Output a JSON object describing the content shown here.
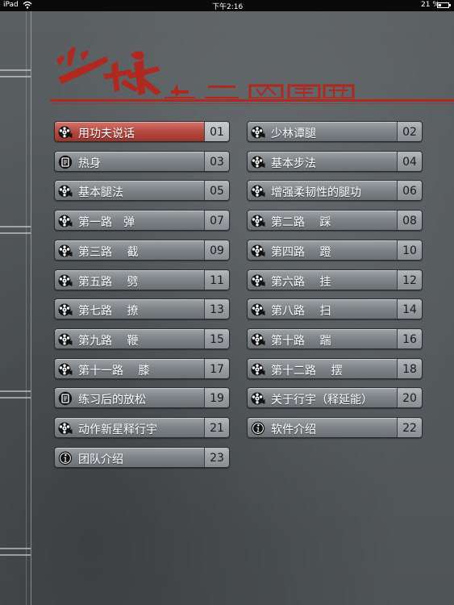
{
  "status_bar": {
    "device": "iPad",
    "time": "下午2:16",
    "battery": "21 %"
  },
  "header": {
    "logo_text": "少林十二路谭腿",
    "accent_color": "#b0281f"
  },
  "menu": [
    {
      "label": "用功夫说话",
      "number": "01",
      "icon": "film-reel-icon",
      "active": true
    },
    {
      "label": "少林谭腿",
      "number": "02",
      "icon": "film-reel-icon"
    },
    {
      "label": "热身",
      "number": "03",
      "icon": "document-icon"
    },
    {
      "label": "基本步法",
      "number": "04",
      "icon": "film-reel-icon"
    },
    {
      "label": "基本腿法",
      "number": "05",
      "icon": "film-reel-icon"
    },
    {
      "label": "增强柔韧性的腿功",
      "number": "06",
      "icon": "film-reel-icon"
    },
    {
      "label": "第一路　弹",
      "number": "07",
      "icon": "film-reel-icon"
    },
    {
      "label": "第二路　 踩",
      "number": "08",
      "icon": "film-reel-icon"
    },
    {
      "label": "第三路　 截",
      "number": "09",
      "icon": "film-reel-icon"
    },
    {
      "label": "第四路　 蹬",
      "number": "10",
      "icon": "film-reel-icon"
    },
    {
      "label": "第五路　 劈",
      "number": "11",
      "icon": "film-reel-icon"
    },
    {
      "label": "第六路　 挂",
      "number": "12",
      "icon": "film-reel-icon"
    },
    {
      "label": "第七路　 撩",
      "number": "13",
      "icon": "film-reel-icon"
    },
    {
      "label": "第八路　 扫",
      "number": "14",
      "icon": "film-reel-icon"
    },
    {
      "label": "第九路　 鞭",
      "number": "15",
      "icon": "film-reel-icon"
    },
    {
      "label": "第十路　 踹",
      "number": "16",
      "icon": "film-reel-icon"
    },
    {
      "label": "第十一路　 膝",
      "number": "17",
      "icon": "film-reel-icon"
    },
    {
      "label": "第十二路　 摆",
      "number": "18",
      "icon": "film-reel-icon"
    },
    {
      "label": "练习后的放松",
      "number": "19",
      "icon": "document-icon"
    },
    {
      "label": "关于行宇（释延能）",
      "number": "20",
      "icon": "film-reel-icon"
    },
    {
      "label": "动作新星释行宇",
      "number": "21",
      "icon": "film-reel-icon"
    },
    {
      "label": "软件介绍",
      "number": "22",
      "icon": "info-icon"
    },
    {
      "label": "团队介绍",
      "number": "23",
      "icon": "info-icon"
    }
  ]
}
